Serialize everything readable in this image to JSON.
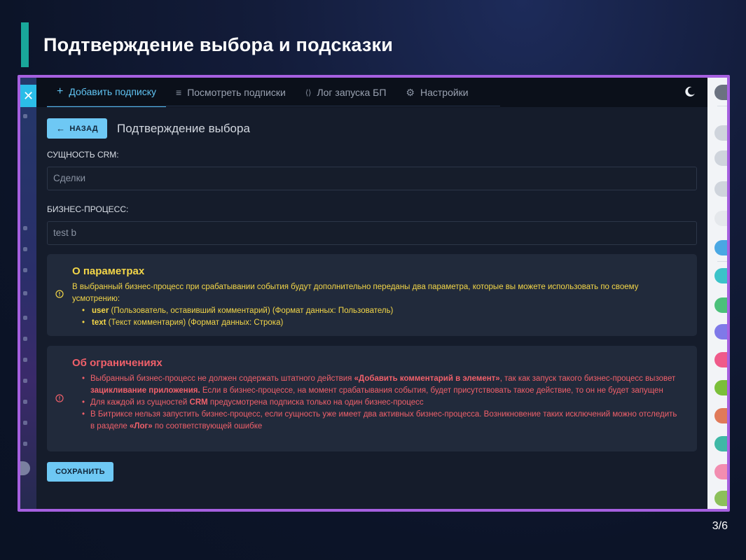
{
  "slide": {
    "title": "Подтверждение выбора и подсказки",
    "counter": "3/6",
    "accent_color": "#19a79a",
    "frame_color": "#a660e0"
  },
  "left_strip": {
    "close_icon": "close-icon",
    "close_label": "✕"
  },
  "tabs": [
    {
      "label": "Добавить подписку",
      "icon": "plus-icon",
      "glyph": "+",
      "active": true
    },
    {
      "label": "Посмотреть подписки",
      "icon": "list-icon",
      "glyph": "≡",
      "active": false
    },
    {
      "label": "Лог запуска БП",
      "icon": "code-icon",
      "glyph": "⟨⟩",
      "active": false
    },
    {
      "label": "Настройки",
      "icon": "sliders-icon",
      "glyph": "⚙",
      "active": false
    }
  ],
  "theme_toggle": {
    "icon": "moon-icon"
  },
  "header": {
    "back_label": "НАЗАД",
    "back_glyph": "←",
    "title": "Подтверждение выбора"
  },
  "form": {
    "crm_label": "СУЩНОСТЬ CRM:",
    "crm_value": "Сделки",
    "bp_label": "БИЗНЕС-ПРОЦЕСС:",
    "bp_value": "test b"
  },
  "params_box": {
    "icon": "info-icon",
    "color": "#f3d648",
    "title": "О параметрах",
    "intro": "В выбранный бизнес-процесс при срабатывании события будут дополнительно переданы два параметра, которые вы можете использовать по своему усмотрению:",
    "items": [
      {
        "name": "user",
        "desc": " (Пользователь, оставивший комментарий) (Формат данных: Пользователь)"
      },
      {
        "name": "text",
        "desc": " (Текст комментария) (Формат данных: Строка)"
      }
    ]
  },
  "limits_box": {
    "icon": "warning-icon",
    "color": "#f0606a",
    "title": "Об ограничениях",
    "item1": {
      "a": "Выбранный бизнес-процесс не должен содержать штатного действия ",
      "b": "«Добавить комментарий в элемент»",
      "c": ", так как запуск такого бизнес-процесс вызовет ",
      "d": "зацикливание приложения.",
      "e": " Если в бизнес-процессе, на момент срабатывания события, будет присутствовать такое действие, то он не будет запущен"
    },
    "item2": {
      "a": "Для каждой из сущностей ",
      "b": "CRM",
      "c": " предусмотрена подписка только на один бизнес-процесс"
    },
    "item3": {
      "a": "В Битриксе нельзя запустить бизнес-процесс, если сущность уже имеет два активных бизнес-процесса. Возникновение таких исключений можно отследить в разделе ",
      "b": "«Лог»",
      "c": " по соответствующей ошибке"
    }
  },
  "save_label": "СОХРАНИТЬ",
  "accent_button_color": "#6ec8f4"
}
